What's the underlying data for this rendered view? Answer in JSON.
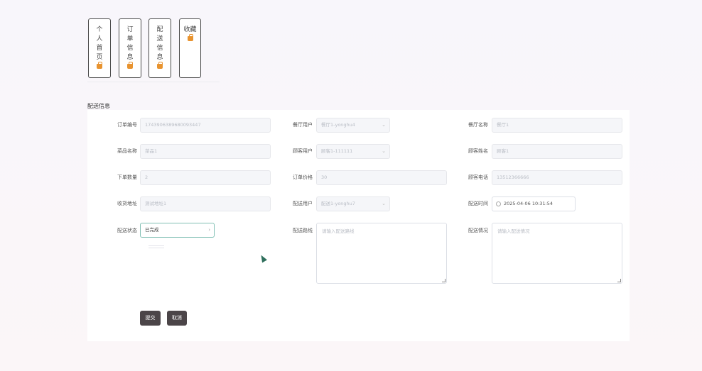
{
  "nav": {
    "items": [
      {
        "label": "个人首页",
        "icon": "bag-icon"
      },
      {
        "label": "订单信息",
        "icon": "bag-icon"
      },
      {
        "label": "配送信息",
        "icon": "bag-icon"
      },
      {
        "label": "收藏",
        "icon": "bag-icon"
      }
    ]
  },
  "section_title": "配送信息",
  "form": {
    "order_no": {
      "label": "订单编号",
      "value": "1743906389680093447"
    },
    "restaurant_user": {
      "label": "餐厅用户",
      "value": "餐厅1-yonghu4"
    },
    "restaurant_name": {
      "label": "餐厅名称",
      "value": "餐厅1"
    },
    "dish_name": {
      "label": "菜品名称",
      "value": "菜品1"
    },
    "customer_user": {
      "label": "顾客用户",
      "value": "顾客1-111111"
    },
    "customer_name": {
      "label": "顾客姓名",
      "value": "顾客1"
    },
    "order_qty": {
      "label": "下单数量",
      "value": "2"
    },
    "order_price": {
      "label": "订单价格",
      "value": "30"
    },
    "customer_phone": {
      "label": "顾客电话",
      "value": "13512366666"
    },
    "address": {
      "label": "收货地址",
      "value": "测试地址1"
    },
    "delivery_user": {
      "label": "配送用户",
      "value": "配送1-yonghu7"
    },
    "delivery_time": {
      "label": "配送时间",
      "value": "2025-04-06 10:31:54"
    },
    "delivery_status": {
      "label": "配送状态",
      "value": "已完成"
    },
    "delivery_route": {
      "label": "配送路线",
      "placeholder": "请输入配送路线"
    },
    "delivery_situation": {
      "label": "配送情况",
      "placeholder": "请输入配送情况"
    }
  },
  "buttons": {
    "submit": "提交",
    "cancel": "取消"
  },
  "colors": {
    "icon_accent": "#e8932f",
    "button_bg": "#4b4548",
    "focus_border": "#7fbfb3"
  }
}
